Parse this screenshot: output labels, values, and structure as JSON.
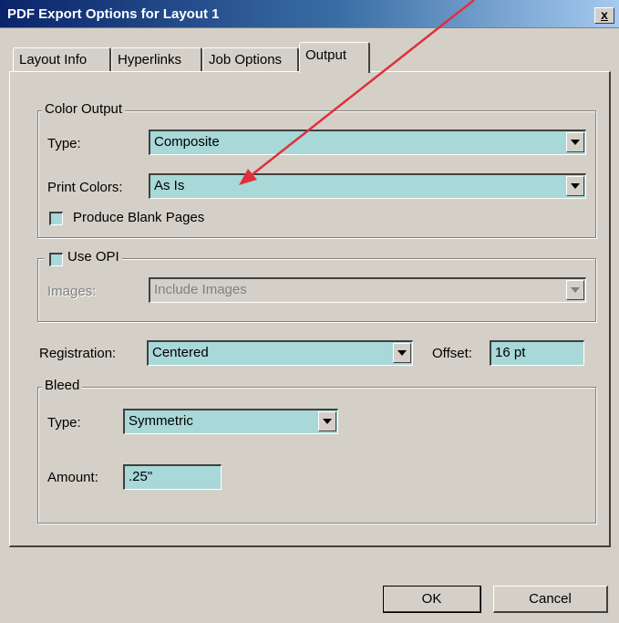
{
  "window": {
    "title": "PDF Export Options for Layout 1",
    "close_label": "x"
  },
  "tabs": [
    {
      "label": "Layout Info",
      "active": false
    },
    {
      "label": "Hyperlinks",
      "active": false
    },
    {
      "label": "Job Options",
      "active": false
    },
    {
      "label": "Output",
      "active": true
    }
  ],
  "color_output": {
    "legend": "Color Output",
    "type_label": "Type:",
    "type_value": "Composite",
    "print_colors_label": "Print Colors:",
    "print_colors_value": "As Is",
    "blank_pages_label": "Produce Blank Pages",
    "blank_pages_checked": false
  },
  "opi": {
    "use_opi_label": "Use OPI",
    "use_opi_checked": false,
    "images_label": "Images:",
    "images_value": "Include Images"
  },
  "registration": {
    "label": "Registration:",
    "value": "Centered",
    "offset_label": "Offset:",
    "offset_value": "16 pt"
  },
  "bleed": {
    "legend": "Bleed",
    "type_label": "Type:",
    "type_value": "Symmetric",
    "amount_label": "Amount:",
    "amount_value": ".25\""
  },
  "buttons": {
    "ok": "OK",
    "cancel": "Cancel"
  },
  "colors": {
    "field_bg": "#a8d8d8",
    "dialog_bg": "#d4d0c8",
    "annotation_arrow": "#e0303a"
  }
}
